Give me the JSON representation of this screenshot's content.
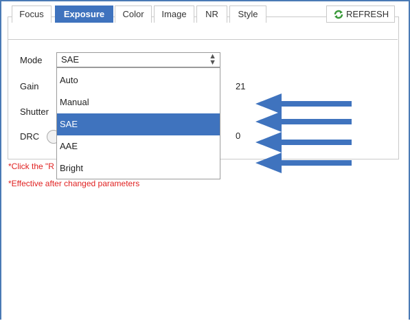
{
  "tabs": [
    {
      "label": "Focus",
      "active": false
    },
    {
      "label": "Exposure",
      "active": true
    },
    {
      "label": "Color",
      "active": false
    },
    {
      "label": "Image",
      "active": false
    },
    {
      "label": "NR",
      "active": false
    },
    {
      "label": "Style",
      "active": false
    }
  ],
  "refresh": {
    "label": "REFRESH",
    "icon": "refresh-icon"
  },
  "settings": {
    "mode_label": "Mode",
    "mode_value": "SAE",
    "gain_label": "Gain",
    "gain_value": "21",
    "shutter_label": "Shutter",
    "drc_label": "DRC",
    "drc_value": "0"
  },
  "dropdown": {
    "options": [
      "Auto",
      "Manual",
      "SAE",
      "AAE",
      "Bright"
    ],
    "selected": "SAE"
  },
  "notes": {
    "click_note": "*Click the \"R",
    "effective_note": "*Effective after changed parameters"
  },
  "colors": {
    "accent": "#3f73be",
    "note": "#e02020",
    "arrow": "#3f73be"
  }
}
